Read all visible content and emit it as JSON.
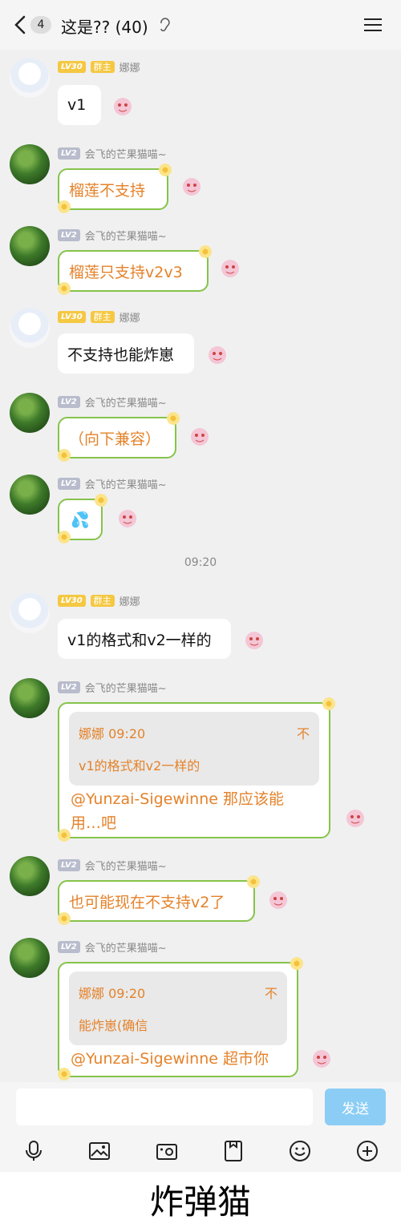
{
  "header": {
    "unread_count": "4",
    "title": "这是?? (40)"
  },
  "chat": {
    "timestamp": "09:20",
    "messages": [
      {
        "sender": "娜娜",
        "level": "LV30",
        "role": "群主",
        "text": "v1"
      },
      {
        "sender": "会飞的芒果猫喵~",
        "level": "LV2",
        "text": "榴莲不支持"
      },
      {
        "sender": "会飞的芒果猫喵~",
        "level": "LV2",
        "text": "榴莲只支持v2v3"
      },
      {
        "sender": "娜娜",
        "level": "LV30",
        "role": "群主",
        "text": "不支持也能炸崽"
      },
      {
        "sender": "会飞的芒果猫喵~",
        "level": "LV2",
        "text": "（向下兼容）"
      },
      {
        "sender": "会飞的芒果猫喵~",
        "level": "LV2",
        "text": "💦"
      },
      {
        "sender": "娜娜",
        "level": "LV30",
        "role": "群主",
        "text": "v1的格式和v2一样的"
      },
      {
        "sender": "会飞的芒果猫喵~",
        "level": "LV2",
        "quote_head": "娜娜 09:20",
        "quote_mark": "不",
        "quote_text": "v1的格式和v2一样的",
        "text_line1": "@Yunzai-Sigewinne 那应该能",
        "text_line2": "用…吧"
      },
      {
        "sender": "会飞的芒果猫喵~",
        "level": "LV2",
        "text": "也可能现在不支持v2了"
      },
      {
        "sender": "会飞的芒果猫喵~",
        "level": "LV2",
        "quote_head": "娜娜 09:20",
        "quote_mark": "不",
        "quote_text": "能炸崽(确信",
        "text_line1": "@Yunzai-Sigewinne 超市你"
      }
    ]
  },
  "input": {
    "send_label": "发送",
    "placeholder": ""
  },
  "toolbar": {
    "icons": [
      "mic-icon",
      "image-icon",
      "camera-icon",
      "file-icon",
      "emoji-icon",
      "plus-icon"
    ]
  },
  "caption": "炸弹猫",
  "colors": {
    "vine_text": "#e4822a",
    "vine_border": "#86c34a",
    "send_bg": "#8ccdf5",
    "badge_gold": "#f5c842"
  }
}
